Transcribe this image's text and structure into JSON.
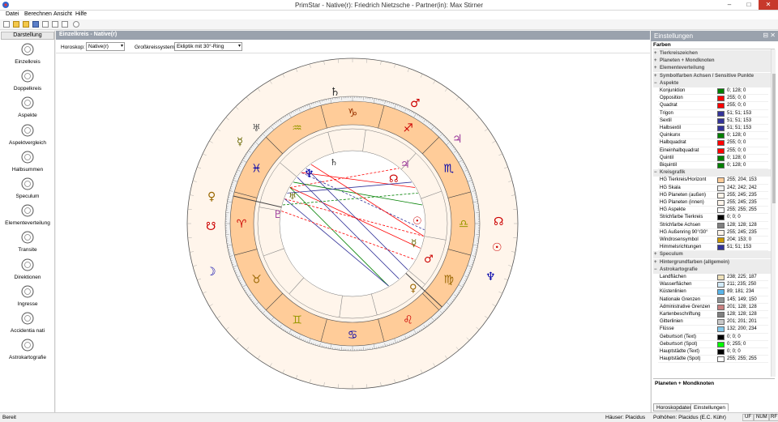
{
  "window": {
    "title": "PrimStar - Native(r): Friedrich Nietzsche - Partner(in): Max Stirner",
    "minimize": "–",
    "maximize": "□",
    "close": "✕"
  },
  "menu": [
    "Datei",
    "Berechnen",
    "Ansicht",
    "Hilfe"
  ],
  "leftpanel": {
    "header": "Darstellung",
    "items": [
      "Einzelkreis",
      "Doppelkreis",
      "Aspekte",
      "Aspektvergleich",
      "Halbsummen",
      "Speculum",
      "Elementeverteilung",
      "Transite",
      "Direktionen",
      "Ingresse",
      "Accidentia nati",
      "Astrokartografie"
    ]
  },
  "document": {
    "tab": "Einzelkreis - Native(r)",
    "horoskop_label": "Horoskop:",
    "horoskop_value": "Native(r)",
    "grosskreis_label": "Großkreissystem:",
    "grosskreis_value": "Ekliptik mit 30°-Ring"
  },
  "chart": {
    "labels": {
      "as_outer": "As",
      "as_inner": "As",
      "mc_outer": "Mc",
      "mc_inner": "Mc"
    },
    "retro": "R"
  },
  "settings": {
    "title": "Einstellungen",
    "section": "Farben",
    "groups_top": [
      "Tierkreiszeichen",
      "Planeten + Mondknoten",
      "Elementeverteilung",
      "Symbolfarben Achsen / Sensitive Punkte"
    ],
    "aspekte_header": "Aspekte",
    "aspekte": [
      {
        "name": "Konjunktion",
        "value": "0; 128; 0",
        "color": "#008000"
      },
      {
        "name": "Opposition",
        "value": "255; 0; 0",
        "color": "#ff0000"
      },
      {
        "name": "Quadrat",
        "value": "255; 0; 0",
        "color": "#ff0000"
      },
      {
        "name": "Trigon",
        "value": "51; 51; 153",
        "color": "#333399"
      },
      {
        "name": "Sextil",
        "value": "51; 51; 153",
        "color": "#333399"
      },
      {
        "name": "Halbsextil",
        "value": "51; 51; 153",
        "color": "#333399"
      },
      {
        "name": "Quinkunx",
        "value": "0; 128; 0",
        "color": "#008000"
      },
      {
        "name": "Halbquadrat",
        "value": "255; 0; 0",
        "color": "#ff0000"
      },
      {
        "name": "Eineinhalbquadrat",
        "value": "255; 0; 0",
        "color": "#ff0000"
      },
      {
        "name": "Quintil",
        "value": "0; 128; 0",
        "color": "#008000"
      },
      {
        "name": "Biquintil",
        "value": "0; 128; 0",
        "color": "#008000"
      }
    ],
    "kreisgrafik_header": "Kreisgrafik",
    "kreisgrafik": [
      {
        "name": "HG Tierkreis/Horizont",
        "value": "255; 204; 153",
        "color": "#ffcc99"
      },
      {
        "name": "HG Skala",
        "value": "242; 242; 242",
        "color": "#f2f2f2"
      },
      {
        "name": "HG Planeten (außen)",
        "value": "255; 245; 235",
        "color": "#fff5eb"
      },
      {
        "name": "HG Planeten (innen)",
        "value": "255; 245; 235",
        "color": "#fff5eb"
      },
      {
        "name": "HG Aspekte",
        "value": "255; 255; 255",
        "color": "#ffffff"
      },
      {
        "name": "Strichfarbe Tierkreis",
        "value": "0; 0; 0",
        "color": "#000000"
      },
      {
        "name": "Strichfarbe Achsen",
        "value": "128; 128; 128",
        "color": "#808080"
      },
      {
        "name": "HG Außenring 90°/30°",
        "value": "255; 245; 235",
        "color": "#fff5eb"
      },
      {
        "name": "Windrosensymbol",
        "value": "204; 153; 0",
        "color": "#cc9900"
      },
      {
        "name": "Himmelsrichtungen",
        "value": "51; 51; 153",
        "color": "#333399"
      }
    ],
    "groups_mid": [
      "Speculum",
      "Hintergrundfarben (allgemein)"
    ],
    "astro_header": "Astrokartografie",
    "astro": [
      {
        "name": "Landflächen",
        "value": "238; 225; 187",
        "color": "#eee1bb"
      },
      {
        "name": "Wasserflächen",
        "value": "211; 235; 250",
        "color": "#d3ebfa"
      },
      {
        "name": "Küstenlinien",
        "value": "89; 181; 234",
        "color": "#59b5ea"
      },
      {
        "name": "Nationale Grenzen",
        "value": "145; 149; 150",
        "color": "#919596"
      },
      {
        "name": "Administrative Grenzen",
        "value": "201; 128; 128",
        "color": "#c98080"
      },
      {
        "name": "Kartenbeschriftung",
        "value": "128; 128; 128",
        "color": "#808080"
      },
      {
        "name": "Gitterlinien",
        "value": "201; 201; 201",
        "color": "#c9c9c9"
      },
      {
        "name": "Flüsse",
        "value": "132; 200; 234",
        "color": "#84c8ea"
      },
      {
        "name": "Geburtsort (Text)",
        "value": "0; 0; 0",
        "color": "#000000"
      },
      {
        "name": "Geburtsort (Spot)",
        "value": "0; 255; 0",
        "color": "#00ff00"
      },
      {
        "name": "Hauptstädte (Text)",
        "value": "0; 0; 0",
        "color": "#000000"
      },
      {
        "name": "Hauptstädte (Spot)",
        "value": "255; 255; 255",
        "color": "#ffffff"
      }
    ],
    "description_title": "Planeten + Mondknoten",
    "tabs": [
      "Horoskopdaten",
      "Einstellungen"
    ]
  },
  "status": {
    "ready": "Bereit",
    "houses": "Häuser: Placidus",
    "polheights": "Polhöhen: Placidus (E.C. Kühr)",
    "uf": "UF",
    "num": "NUM",
    "rf": "RF"
  }
}
